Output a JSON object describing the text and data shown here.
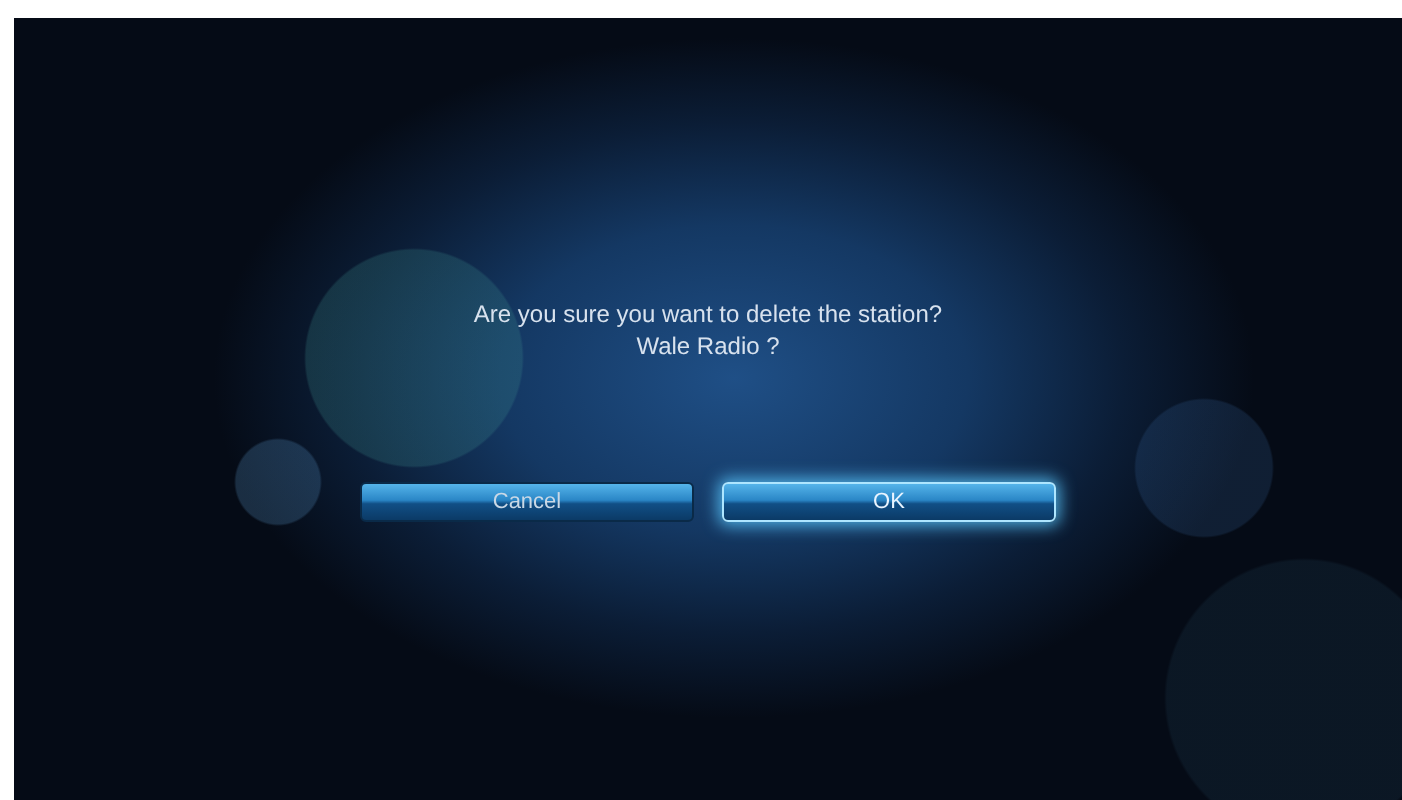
{
  "dialog": {
    "message_lines": [
      "Are you sure you want to delete the station?",
      "Wale Radio ?"
    ],
    "buttons": [
      {
        "label": "Cancel",
        "selected": false
      },
      {
        "label": "OK",
        "selected": true
      }
    ]
  }
}
